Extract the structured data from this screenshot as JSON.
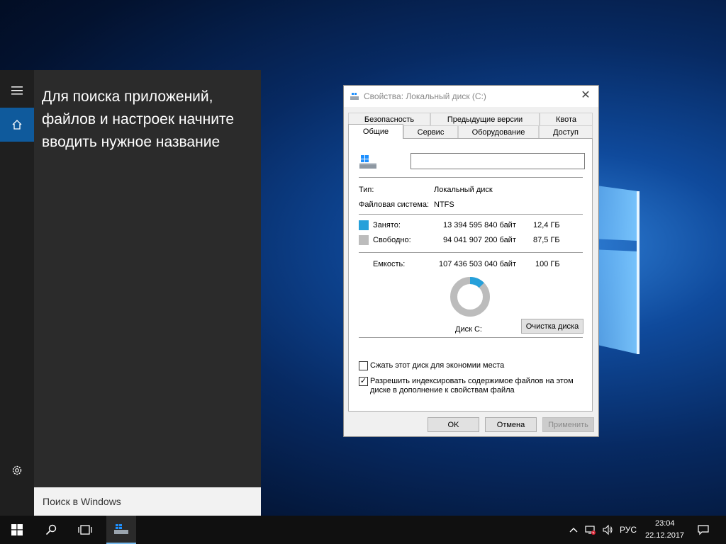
{
  "start": {
    "hint": "Для поиска приложений, файлов и настроек начните вводить нужное название",
    "search_placeholder": "Поиск в Windows"
  },
  "taskbar": {
    "language": "РУС",
    "time": "23:04",
    "date": "22.12.2017"
  },
  "dialog": {
    "title": "Свойства: Локальный диск (C:)",
    "tabs_row1": [
      "Безопасность",
      "Предыдущие версии",
      "Квота"
    ],
    "tabs_row2": [
      "Общие",
      "Сервис",
      "Оборудование",
      "Доступ"
    ],
    "active_tab": "Общие",
    "drive_name_value": "",
    "type_label": "Тип:",
    "type_value": "Локальный диск",
    "fs_label": "Файловая система:",
    "fs_value": "NTFS",
    "used_label": "Занято:",
    "used_bytes": "13 394 595 840 байт",
    "used_size": "12,4 ГБ",
    "free_label": "Свободно:",
    "free_bytes": "94 041 907 200 байт",
    "free_size": "87,5 ГБ",
    "capacity_label": "Емкость:",
    "capacity_bytes": "107 436 503 040 байт",
    "capacity_size": "100 ГБ",
    "used_fraction": 0.1247,
    "drive_label": "Диск C:",
    "cleanup_button": "Очистка диска",
    "compress_label": "Сжать этот диск для экономии места",
    "compress_checked": false,
    "index_label_line1": "Разрешить индексировать содержимое файлов на этом",
    "index_label_line2": "диске в дополнение к свойствам файла",
    "index_checked": true,
    "ok_button": "OK",
    "cancel_button": "Отмена",
    "apply_button": "Применить",
    "colors": {
      "used": "#26a0da",
      "free": "#bcbcbc"
    }
  }
}
